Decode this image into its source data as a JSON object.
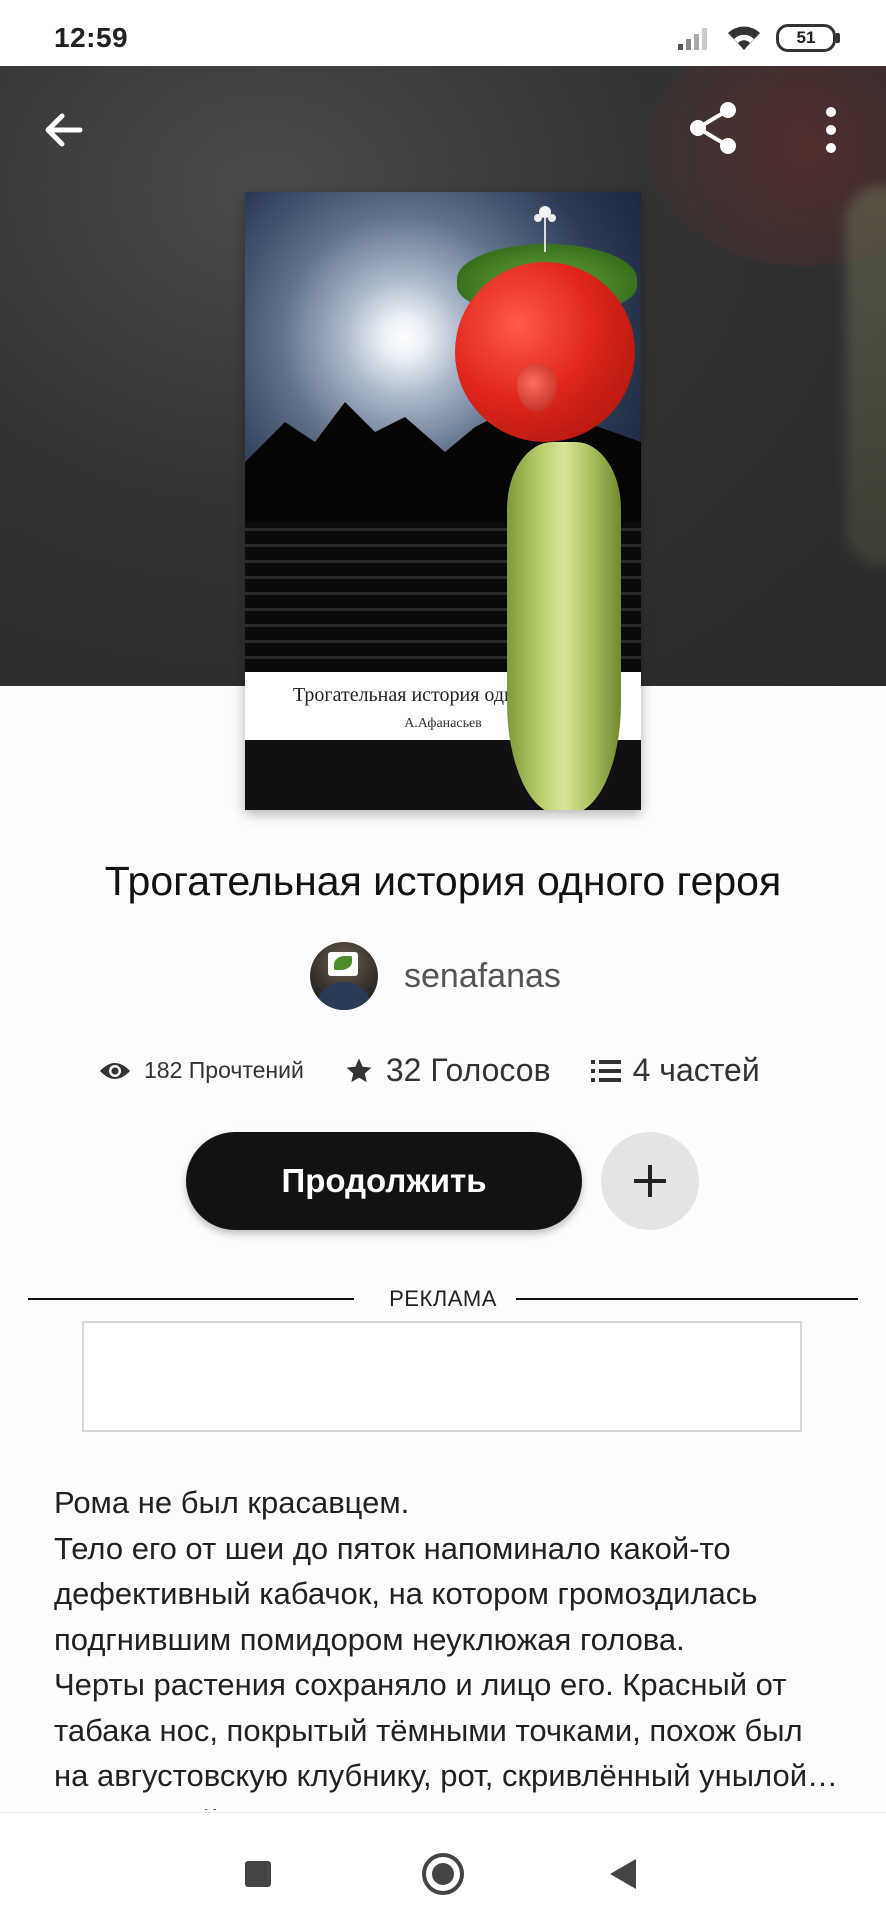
{
  "status_bar": {
    "time": "12:59",
    "battery": "51"
  },
  "cover": {
    "title": "Трогательная история одного героя",
    "author": "А.Афанасьев"
  },
  "book": {
    "title": "Трогательная история одного героя",
    "author_name": "senafanas"
  },
  "stats": {
    "reads": "182 Прочтений",
    "votes": "32 Голосов",
    "parts": "4 частей"
  },
  "actions": {
    "continue_label": "Продолжить"
  },
  "ad": {
    "label": "РЕКЛАМА"
  },
  "story": {
    "paragraphs": [
      "Рома не был красавцем.",
      "Тело его от шеи до пяток напоминало какой-то дефективный кабачок, на котором громоздилась подгнившим помидором неуклюжая голова.",
      "Черты растения сохраняло и лицо его. Красный от табака нос, покрытый тёмными точками, похож был на августовскую клубнику, рот, скривлённый унылой… не зеленый стручок, а не ухмо: почно"
    ]
  },
  "colors": {
    "button_dark": "#121212",
    "add_button_bg": "#e4e3e6",
    "hero_bg": "#333333"
  },
  "icons": [
    "arrow-left-icon",
    "share-icon",
    "more-vert-icon",
    "eye-icon",
    "star-icon",
    "list-icon",
    "plus-icon"
  ]
}
